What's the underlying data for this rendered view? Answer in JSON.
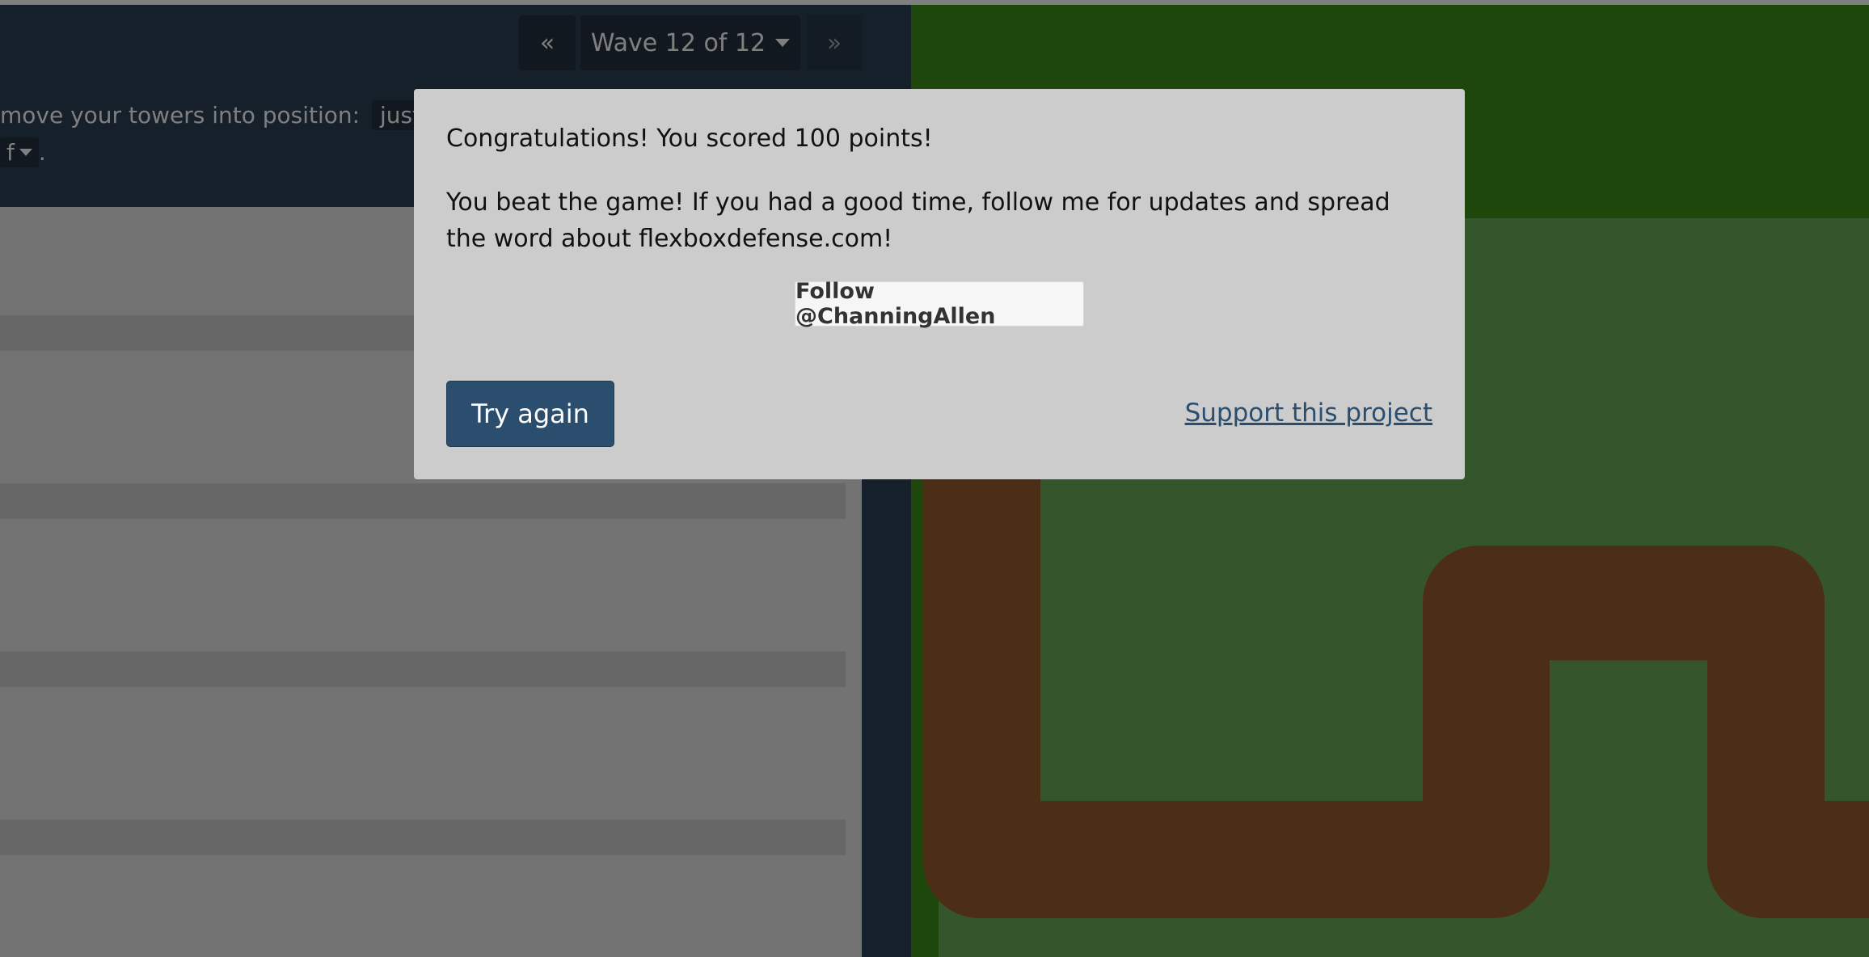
{
  "nav": {
    "prev_icon": "«",
    "wave_label": "Wave 12 of 12",
    "next_icon": "»"
  },
  "instructions": {
    "line1_text": "move your towers into position:",
    "line1_code": "justify",
    "line2_code": "f",
    "line2_end": "."
  },
  "modal": {
    "score_text": "Congratulations! You scored 100 points!",
    "message_text": "You beat the game! If you had a good time, follow me for updates and spread the word about flexboxdefense.com!",
    "follow_label": "Follow @ChanningAllen",
    "try_again_label": "Try again",
    "support_label": "Support this project"
  },
  "colors": {
    "panel": "#2c4155",
    "board_grass": "#6aaa5a",
    "board_top": "#3a8e17",
    "path": "#985d2d",
    "modal_bg": "#cccccc",
    "primary_button": "#2c4e6e"
  },
  "icons": {
    "prev": "double-chevron-left-icon",
    "next": "double-chevron-right-icon",
    "dropdown": "caret-down-icon"
  }
}
